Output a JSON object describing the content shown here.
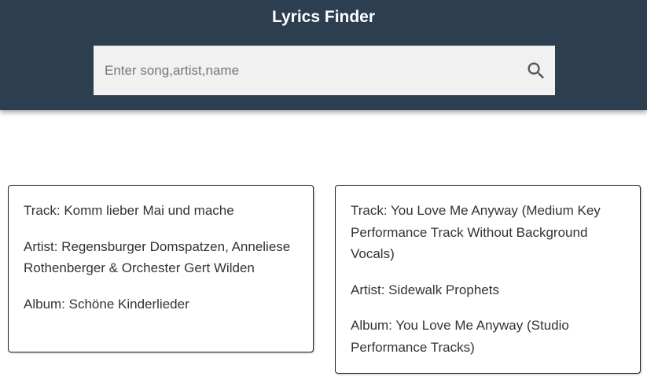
{
  "header": {
    "title": "Lyrics Finder"
  },
  "search": {
    "placeholder": "Enter song,artist,name",
    "value": "",
    "icon": "search-icon"
  },
  "results": [
    {
      "track": "Track: Komm lieber Mai und mache",
      "artist": "Artist: Regensburger Domspatzen, Anneliese Rothenberger & Orchester Gert Wilden",
      "album": "Album: Schöne Kinderlieder"
    },
    {
      "track": "Track: You Love Me Anyway (Medium Key Performance Track Without Background Vocals)",
      "artist": "Artist: Sidewalk Prophets",
      "album": "Album: You Love Me Anyway (Studio Performance Tracks)"
    }
  ],
  "colors": {
    "header_bg": "#2c3e50",
    "search_bg": "#f1f1f1",
    "text": "#333333"
  }
}
